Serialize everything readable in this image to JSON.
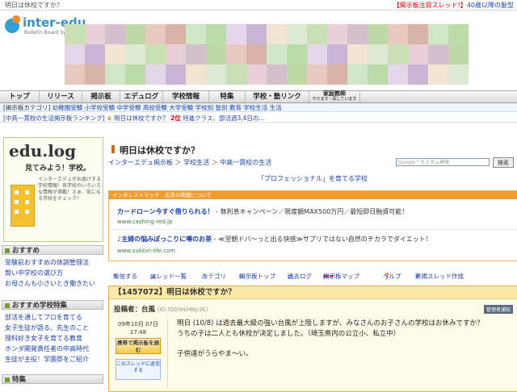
{
  "top_bar": {
    "page_title": "明日は休校ですか？",
    "hot_label": "【掲示板注目スレッド!】",
    "hot_thread": "40歳以降の髪型"
  },
  "logo": {
    "name": "inter-edu.",
    "sub": "Bulletin Board System"
  },
  "nav": {
    "items": [
      "トップ",
      "リリース",
      "掲示板",
      "エデュログ",
      "学校情報",
      "特集",
      "学校・塾リンク"
    ],
    "kateikyoushi": "家庭教師",
    "kateikyoushi_sub": "やります・探しています"
  },
  "categories": {
    "lead": "[掲示板カテゴリ]",
    "items": [
      "幼稚園受験",
      "小学校受験",
      "中学受験",
      "高校受験",
      "大学受験",
      "学校別",
      "塾別",
      "教育",
      "学校生活",
      "生活"
    ]
  },
  "ticker": {
    "ranking": "[中高一貫校の生活掲示板ランキング]",
    "first": "明日は休校ですか？",
    "rank2": "2位",
    "second": "特進クラス、部活週3,4日の..."
  },
  "sidebar": {
    "edulog_title": "edu.log",
    "edulog_sub": "見てみよう！学校。",
    "edulog_desc": "インターエデュがお届けする学校情報！各学校のいろいろな情報が満載！さぁ、気になる学校をチェック！",
    "section1": "おすすめ",
    "section1_links": [
      "受験前おすすめの体調管理法",
      "賢い中学校の選び方",
      "お母さんも小さいとき働きたい"
    ],
    "section2": "おすすめ学校特集",
    "section2_links": [
      "部活を通してプロを育てる",
      "女子生徒が語る、先生のこと",
      "理科好き女子を育てる教育",
      "ホンダ開発責任者の中高時代",
      "生徒が主役！学園祭をご紹介"
    ],
    "section3": "特集"
  },
  "main": {
    "title": "明日は休校ですか？",
    "breadcrumb": [
      "インターエデュ掲示板",
      "学校生活",
      "中高一貫校の生活"
    ],
    "search_placeholder": "Google™カスタム検索",
    "search_button": "検索",
    "promo": "「プロフェッショナル」を育てる学校"
  },
  "ad": {
    "header": "インタレストマッチ - 広告の掲載について",
    "ad1_title": "カードローン今すぐ借りられる！",
    "ad1_text": " - 無利息キャンペーン／限度額MAX500万円／最短即日融資可能！",
    "ad1_url": "www.cashing-red.jp",
    "ad2_title": "♪主婦の悩みぽっこりに噂のお茶",
    "ad2_text": " - ≪翌朝ドバ～っと出る快感≫サプリではない自然のチカラでダイエット！",
    "ad2_url": "www.sukkiri-life.com"
  },
  "tools": {
    "reply": "返信する",
    "thread_list": "スレッド一覧",
    "category": "カテゴリ",
    "board_top": "掲示板トップ",
    "past_log": "過去ログ",
    "new_badge": "new",
    "board_map": "掲示板マップ",
    "help": "ヘルプ",
    "new_thread": "新規スレッド作成"
  },
  "post": {
    "number_title": "【1457072】明日は休校ですか？",
    "poster_label": "投稿者：",
    "poster_name": "台風",
    "poster_id": "(ID:lQOWkHBp3E)",
    "admin_badge": "管理者通知",
    "date": "09年10月 07日",
    "time": "17:48",
    "mobile_button": "携帯で掲示板を読む",
    "watch_button": "このスレッドに返信する",
    "body_line1": "明日 (10/8) は過去最大級の強い台風が上陸しますが、みなさんのお子さんの学校はお休みですか？",
    "body_line2": "うちの子は二人とも休校が決定しました。（埼玉県内の公立小、私立中）",
    "body_line3": "子供達がうらやま～い。"
  },
  "colors": {
    "link": "#1a3fae",
    "accent_orange": "#f39c2e",
    "nav_border": "#999999"
  }
}
